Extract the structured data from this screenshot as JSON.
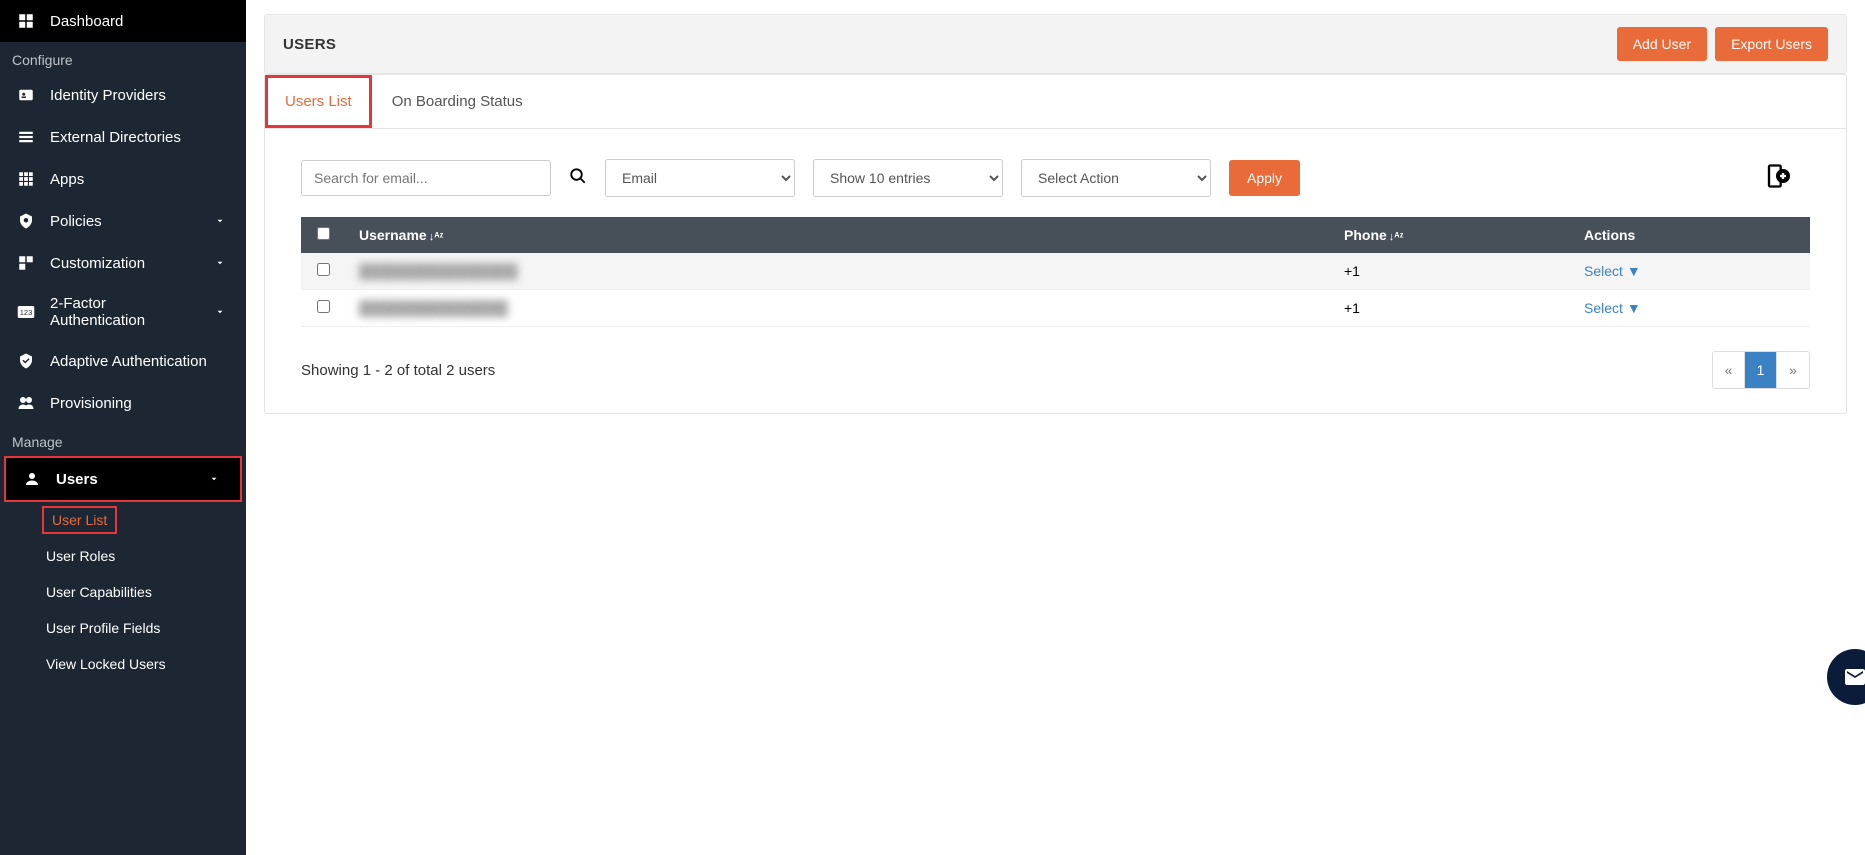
{
  "sidebar": {
    "dashboard": "Dashboard",
    "section_configure": "Configure",
    "identity_providers": "Identity Providers",
    "external_directories": "External Directories",
    "apps": "Apps",
    "policies": "Policies",
    "customization": "Customization",
    "two_factor": "2-Factor Authentication",
    "adaptive_auth": "Adaptive Authentication",
    "provisioning": "Provisioning",
    "section_manage": "Manage",
    "users": "Users",
    "submenu": {
      "user_list": "User List",
      "user_roles": "User Roles",
      "user_capabilities": "User Capabilities",
      "user_profile_fields": "User Profile Fields",
      "view_locked_users": "View Locked Users"
    }
  },
  "header": {
    "title": "USERS",
    "add_user": "Add User",
    "export_users": "Export Users"
  },
  "tabs": {
    "users_list": "Users List",
    "on_boarding_status": "On Boarding Status"
  },
  "controls": {
    "search_placeholder": "Search for email...",
    "email_select": "Email",
    "entries_select": "Show 10 entries",
    "action_select": "Select Action",
    "apply": "Apply"
  },
  "table": {
    "col_username": "Username",
    "col_phone": "Phone",
    "col_actions": "Actions",
    "rows": [
      {
        "username": "████████████████",
        "phone": "+1",
        "action": "Select"
      },
      {
        "username": "███████████████",
        "phone": "+1",
        "action": "Select"
      }
    ]
  },
  "footer": {
    "showing": "Showing 1 - 2 of total 2 users",
    "page_prev": "«",
    "page_1": "1",
    "page_next": "»"
  }
}
